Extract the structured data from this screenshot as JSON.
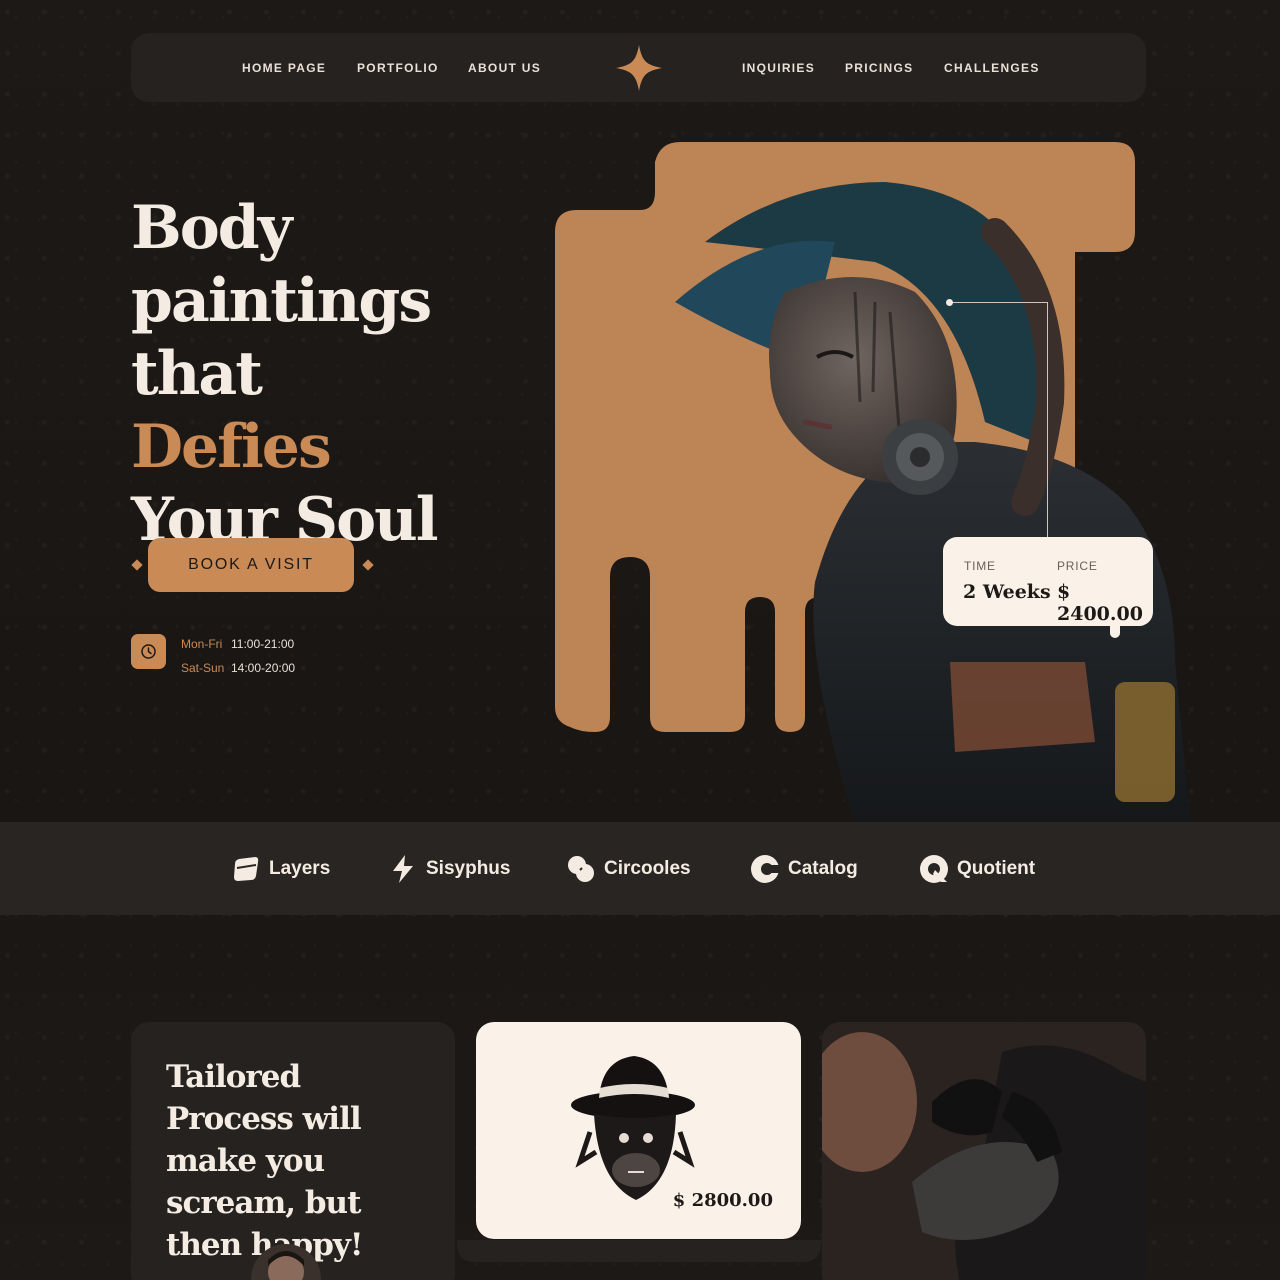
{
  "nav": {
    "links_left": [
      "HOME PAGE",
      "PORTFOLIO",
      "ABOUT US"
    ],
    "links_right": [
      "INQUIRIES",
      "PRICINGS",
      "CHALLENGES"
    ]
  },
  "hero": {
    "headline_1": "Body",
    "headline_2": "paintings",
    "headline_3a": "that ",
    "headline_3b": "Defies",
    "headline_4": "Your Soul",
    "cta": "BOOK A VISIT",
    "hours": [
      {
        "day": "Mon-Fri",
        "time": "11:00-21:00"
      },
      {
        "day": "Sat-Sun",
        "time": "14:00-20:00"
      }
    ]
  },
  "price_card": {
    "time_label": "TIME",
    "time_value": "2 Weeks",
    "price_label": "PRICE",
    "price_value": "$ 2400.00"
  },
  "logos": [
    "Layers",
    "Sisyphus",
    "Circooles",
    "Catalog",
    "Quotient"
  ],
  "cards": {
    "process_title": "Tailored Process will make you scream, but then happy!",
    "design_price": "$ 2800.00"
  },
  "colors": {
    "background": "#1c1816",
    "accent": "#c98a55",
    "cream": "#faf1e8",
    "panel": "#262220"
  }
}
